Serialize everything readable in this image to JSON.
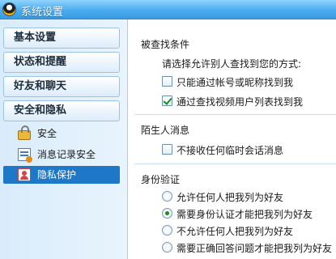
{
  "window": {
    "title": "系统设置",
    "icon": "qq-penguin-icon"
  },
  "sidebar": {
    "categories": [
      {
        "label": "基本设置"
      },
      {
        "label": "状态和提醒"
      },
      {
        "label": "好友和聊天"
      },
      {
        "label": "安全和隐私"
      }
    ],
    "items": [
      {
        "label": "安全",
        "icon": "lock-icon"
      },
      {
        "label": "消息记录安全",
        "icon": "message-record-icon"
      },
      {
        "label": "隐私保护",
        "icon": "privacy-icon",
        "selected": true
      }
    ]
  },
  "sections": {
    "find": {
      "title": "被查找条件",
      "prompt": "请选择允许别人查找到您的方式:",
      "options": [
        {
          "label": "只能通过帐号或昵称找到我",
          "checked": false
        },
        {
          "label": "通过查找视频用户列表找到我",
          "checked": true
        }
      ]
    },
    "stranger": {
      "title": "陌生人消息",
      "options": [
        {
          "label": "不接收任何临时会话消息",
          "checked": false
        }
      ]
    },
    "auth": {
      "title": "身份验证",
      "options": [
        {
          "label": "允许任何人把我列为好友",
          "checked": false
        },
        {
          "label": "需要身份认证才能把我列为好友",
          "checked": true
        },
        {
          "label": "不允许任何人把我列为好友",
          "checked": false
        },
        {
          "label": "需要正确回答问题才能把我列为好友",
          "checked": false
        }
      ]
    }
  },
  "colors": {
    "accent": "#1f77c8",
    "titlebar": "#47a9ee",
    "check": "#1d8b1d"
  }
}
